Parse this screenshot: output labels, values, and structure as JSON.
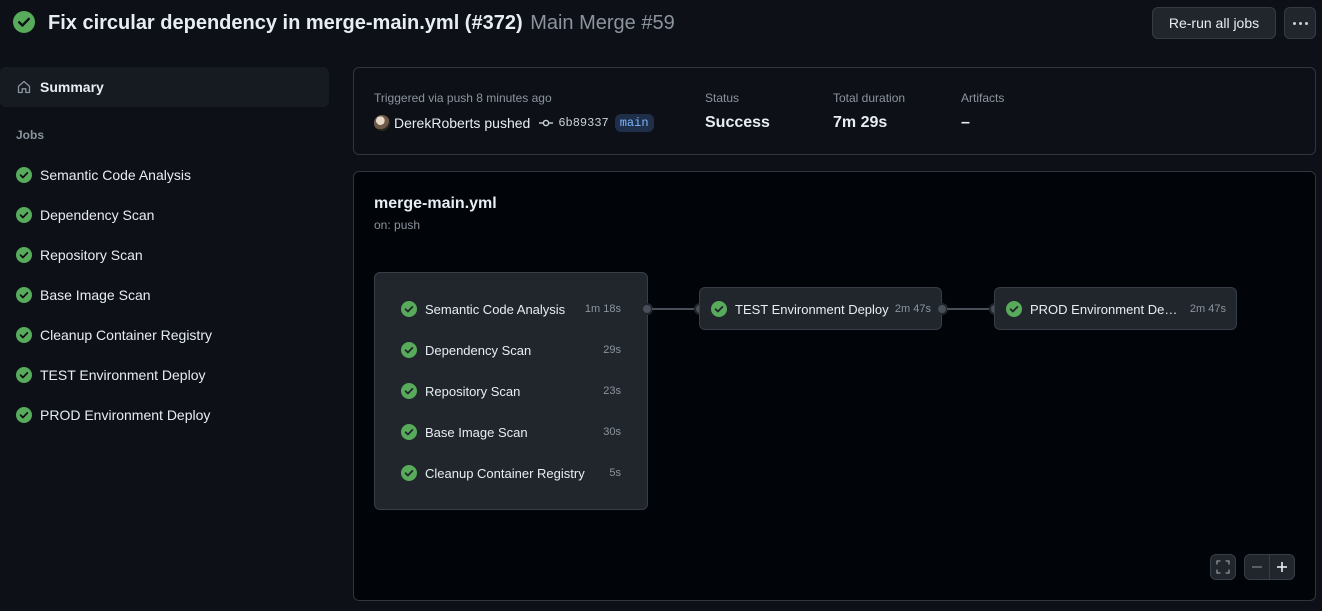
{
  "header": {
    "title": "Fix circular dependency in merge-main.yml (#372)",
    "run_name": "Main Merge #59",
    "rerun_label": "Re-run all jobs",
    "status_icon": "check-circle-fill-icon",
    "more_icon": "kebab-horizontal-icon"
  },
  "sidebar": {
    "summary_label": "Summary",
    "summary_icon": "home-icon",
    "jobs_heading": "Jobs",
    "jobs": [
      {
        "name": "Semantic Code Analysis"
      },
      {
        "name": "Dependency Scan"
      },
      {
        "name": "Repository Scan"
      },
      {
        "name": "Base Image Scan"
      },
      {
        "name": "Cleanup Container Registry"
      },
      {
        "name": "TEST Environment Deploy"
      },
      {
        "name": "PROD Environment Deploy"
      }
    ]
  },
  "run": {
    "trigger_label": "Triggered via push 8 minutes ago",
    "actor": "DerekRoberts",
    "action": "pushed",
    "commit": "6b89337",
    "branch": "main",
    "status_label": "Status",
    "status_value": "Success",
    "duration_label": "Total duration",
    "duration_value": "7m 29s",
    "artifacts_label": "Artifacts",
    "artifacts_value": "–"
  },
  "workflow": {
    "file": "merge-main.yml",
    "trigger": "on: push",
    "stage1": [
      {
        "name": "Semantic Code Analysis",
        "duration": "1m 18s"
      },
      {
        "name": "Dependency Scan",
        "duration": "29s"
      },
      {
        "name": "Repository Scan",
        "duration": "23s"
      },
      {
        "name": "Base Image Scan",
        "duration": "30s"
      },
      {
        "name": "Cleanup Container Registry",
        "duration": "5s"
      }
    ],
    "stage2": {
      "name": "TEST Environment Deploy",
      "duration": "2m 47s"
    },
    "stage3": {
      "name": "PROD Environment Deploy",
      "duration": "2m 47s"
    }
  },
  "colors": {
    "success": "#57ab5a",
    "background": "#0d1117",
    "accent_branch": "#7ab7ff"
  }
}
